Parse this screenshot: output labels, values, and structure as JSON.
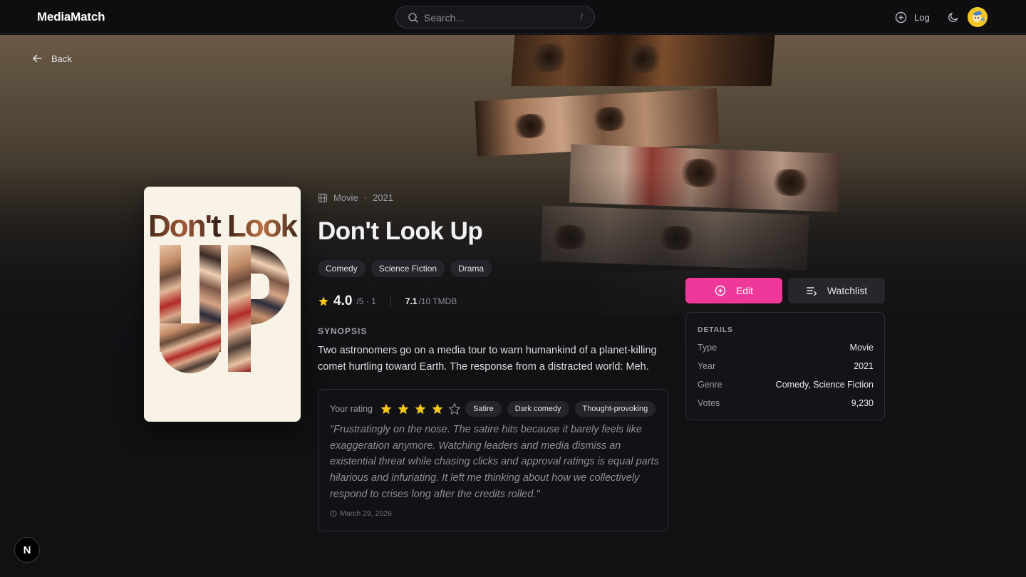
{
  "app": {
    "brand": "MediaMatch"
  },
  "header": {
    "search_placeholder": "Search...",
    "search_shortcut": "/",
    "log_label": "Log"
  },
  "nav": {
    "back_label": "Back"
  },
  "movie": {
    "type": "Movie",
    "separator": "·",
    "year": "2021",
    "title": "Don't Look Up",
    "poster_title": "Don't Look",
    "genres": [
      "Comedy",
      "Science Fiction",
      "Drama"
    ],
    "rating": {
      "value": "4.0",
      "scale": "/5 · 1",
      "tmdb_value": "7.1",
      "tmdb_scale": "/10 TMDB"
    },
    "synopsis_heading": "SYNOPSIS",
    "synopsis": "Two astronomers go on a media tour to warn humankind of a planet-killing comet hurtling toward Earth. The response from a distracted world: Meh."
  },
  "review": {
    "label": "Your rating",
    "stars_filled": 4,
    "stars_total": 5,
    "tags": [
      "Satire",
      "Dark comedy",
      "Thought-provoking"
    ],
    "text": "\"Frustratingly on the nose. The satire hits because it barely feels like exaggeration anymore. Watching leaders and media dismiss an existential threat while chasing clicks and approval ratings is equal parts hilarious and infuriating. It left me thinking about how we collectively respond to crises long after the credits rolled.\"",
    "date": "March 29, 2026"
  },
  "actions": {
    "edit_label": "Edit",
    "watchlist_label": "Watchlist"
  },
  "details": {
    "heading": "DETAILS",
    "rows": [
      {
        "key": "Type",
        "value": "Movie"
      },
      {
        "key": "Year",
        "value": "2021"
      },
      {
        "key": "Genre",
        "value": "Comedy, Science Fiction"
      },
      {
        "key": "Votes",
        "value": "9,230"
      }
    ]
  },
  "dev_badge": "N",
  "colors": {
    "accent": "#f0389a",
    "star": "#f5c518",
    "background": "#111114"
  },
  "icons": [
    "search-icon",
    "plus-circle-icon",
    "moon-icon",
    "arrow-left-icon",
    "film-icon",
    "star-icon",
    "clock-icon",
    "list-add-icon"
  ]
}
